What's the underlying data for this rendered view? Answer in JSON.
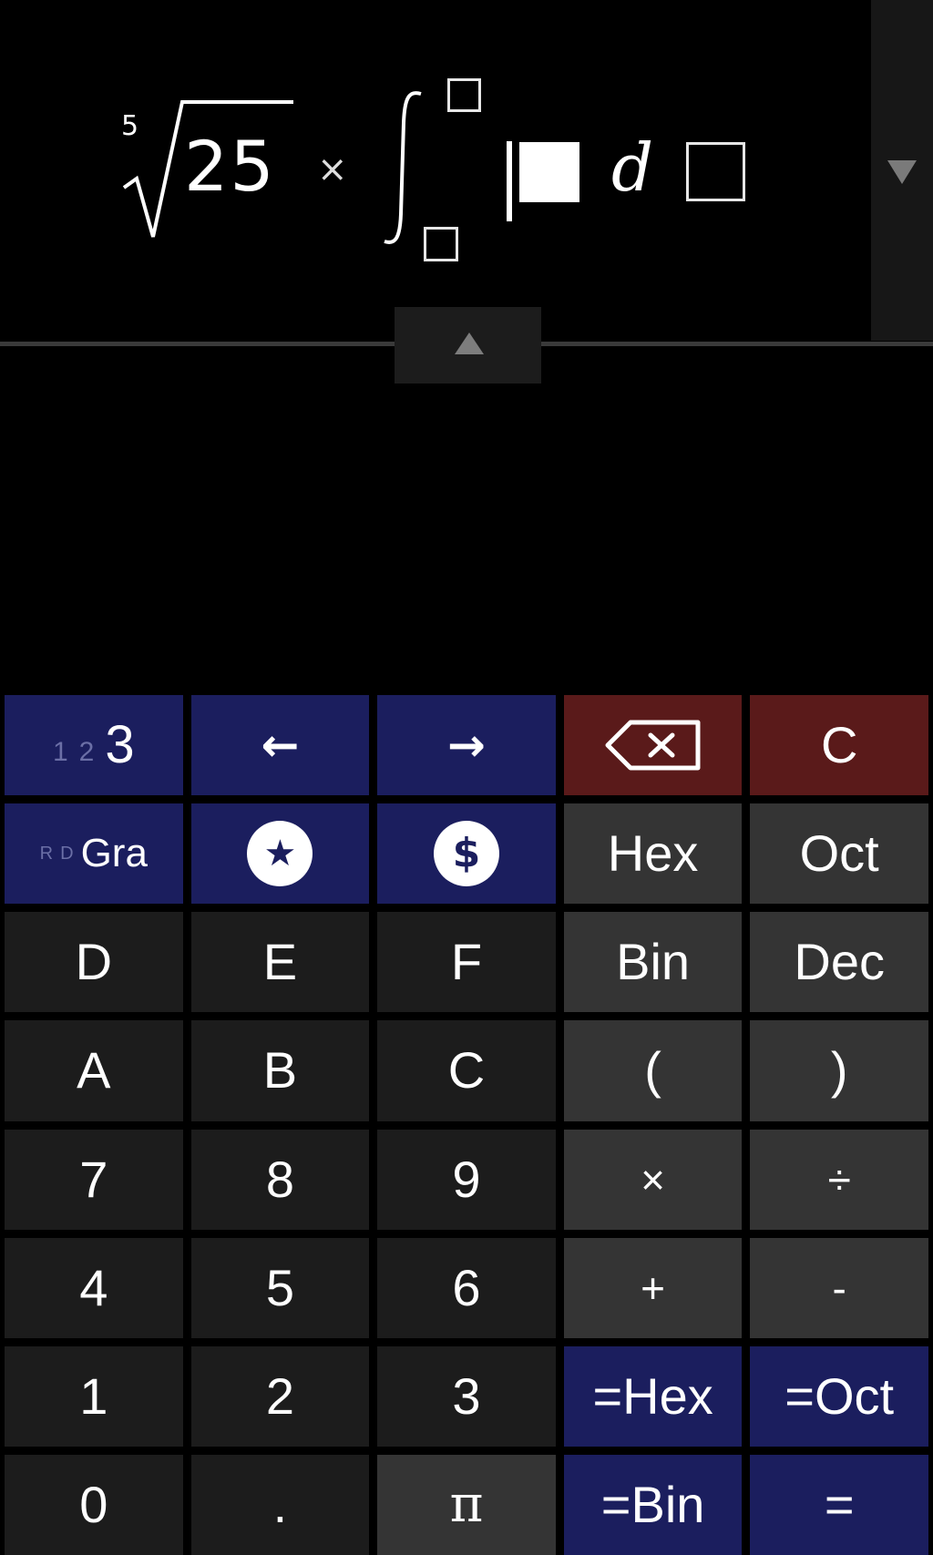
{
  "expression": {
    "root_index": "5",
    "radicand": "25",
    "operator": "×",
    "differential": "d"
  },
  "keypad": {
    "row1": {
      "digit_mode_dim": [
        "1",
        "2"
      ],
      "digit_mode_active": "3",
      "left_arrow": "←",
      "right_arrow": "→",
      "clear": "C"
    },
    "row2": {
      "angle_mode_dim": [
        "R",
        "D"
      ],
      "angle_mode_active": "Gra",
      "favorites_icon": "★",
      "currency_icon": "$",
      "hex": "Hex",
      "oct": "Oct"
    },
    "row3": [
      "D",
      "E",
      "F",
      "Bin",
      "Dec"
    ],
    "row4": [
      "A",
      "B",
      "C",
      "(",
      ")"
    ],
    "row5": [
      "7",
      "8",
      "9",
      "×",
      "÷"
    ],
    "row6": [
      "4",
      "5",
      "6",
      "+",
      "-"
    ],
    "row7": [
      "1",
      "2",
      "3",
      "=Hex",
      "=Oct"
    ],
    "row8": [
      "0",
      ".",
      "π",
      "=Bin",
      "="
    ]
  },
  "colors": {
    "blue_key": "#1b1e5e",
    "red_key": "#5a1a1a",
    "dark_key": "#1c1c1c",
    "gray_key": "#343434"
  },
  "icons": {
    "history": "chevron-down-icon",
    "collapse": "chevron-up-icon",
    "backspace": "backspace-icon",
    "favorites": "star-icon",
    "currency": "dollar-icon"
  }
}
